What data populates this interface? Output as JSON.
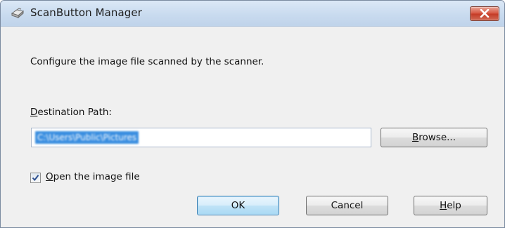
{
  "window": {
    "title": "ScanButton Manager",
    "icon": "scanner-icon",
    "close_icon": "close-icon"
  },
  "description": "Configure the image file scanned by the scanner.",
  "destination": {
    "label_accel": "D",
    "label_rest": "estination Path:",
    "value": "C:\\Users\\Public\\Pictures",
    "value_note": "text is selected and blurred in the screenshot"
  },
  "buttons": {
    "browse_accel": "B",
    "browse_rest": "rowse...",
    "ok": "OK",
    "cancel": "Cancel",
    "help_accel": "H",
    "help_rest": "elp"
  },
  "open_image": {
    "checked": true,
    "label_accel": "O",
    "label_rest": "pen the image file"
  },
  "colors": {
    "selection": "#3a8ee0",
    "close_button": "#c43a25",
    "default_button_border": "#3c7fb1"
  }
}
